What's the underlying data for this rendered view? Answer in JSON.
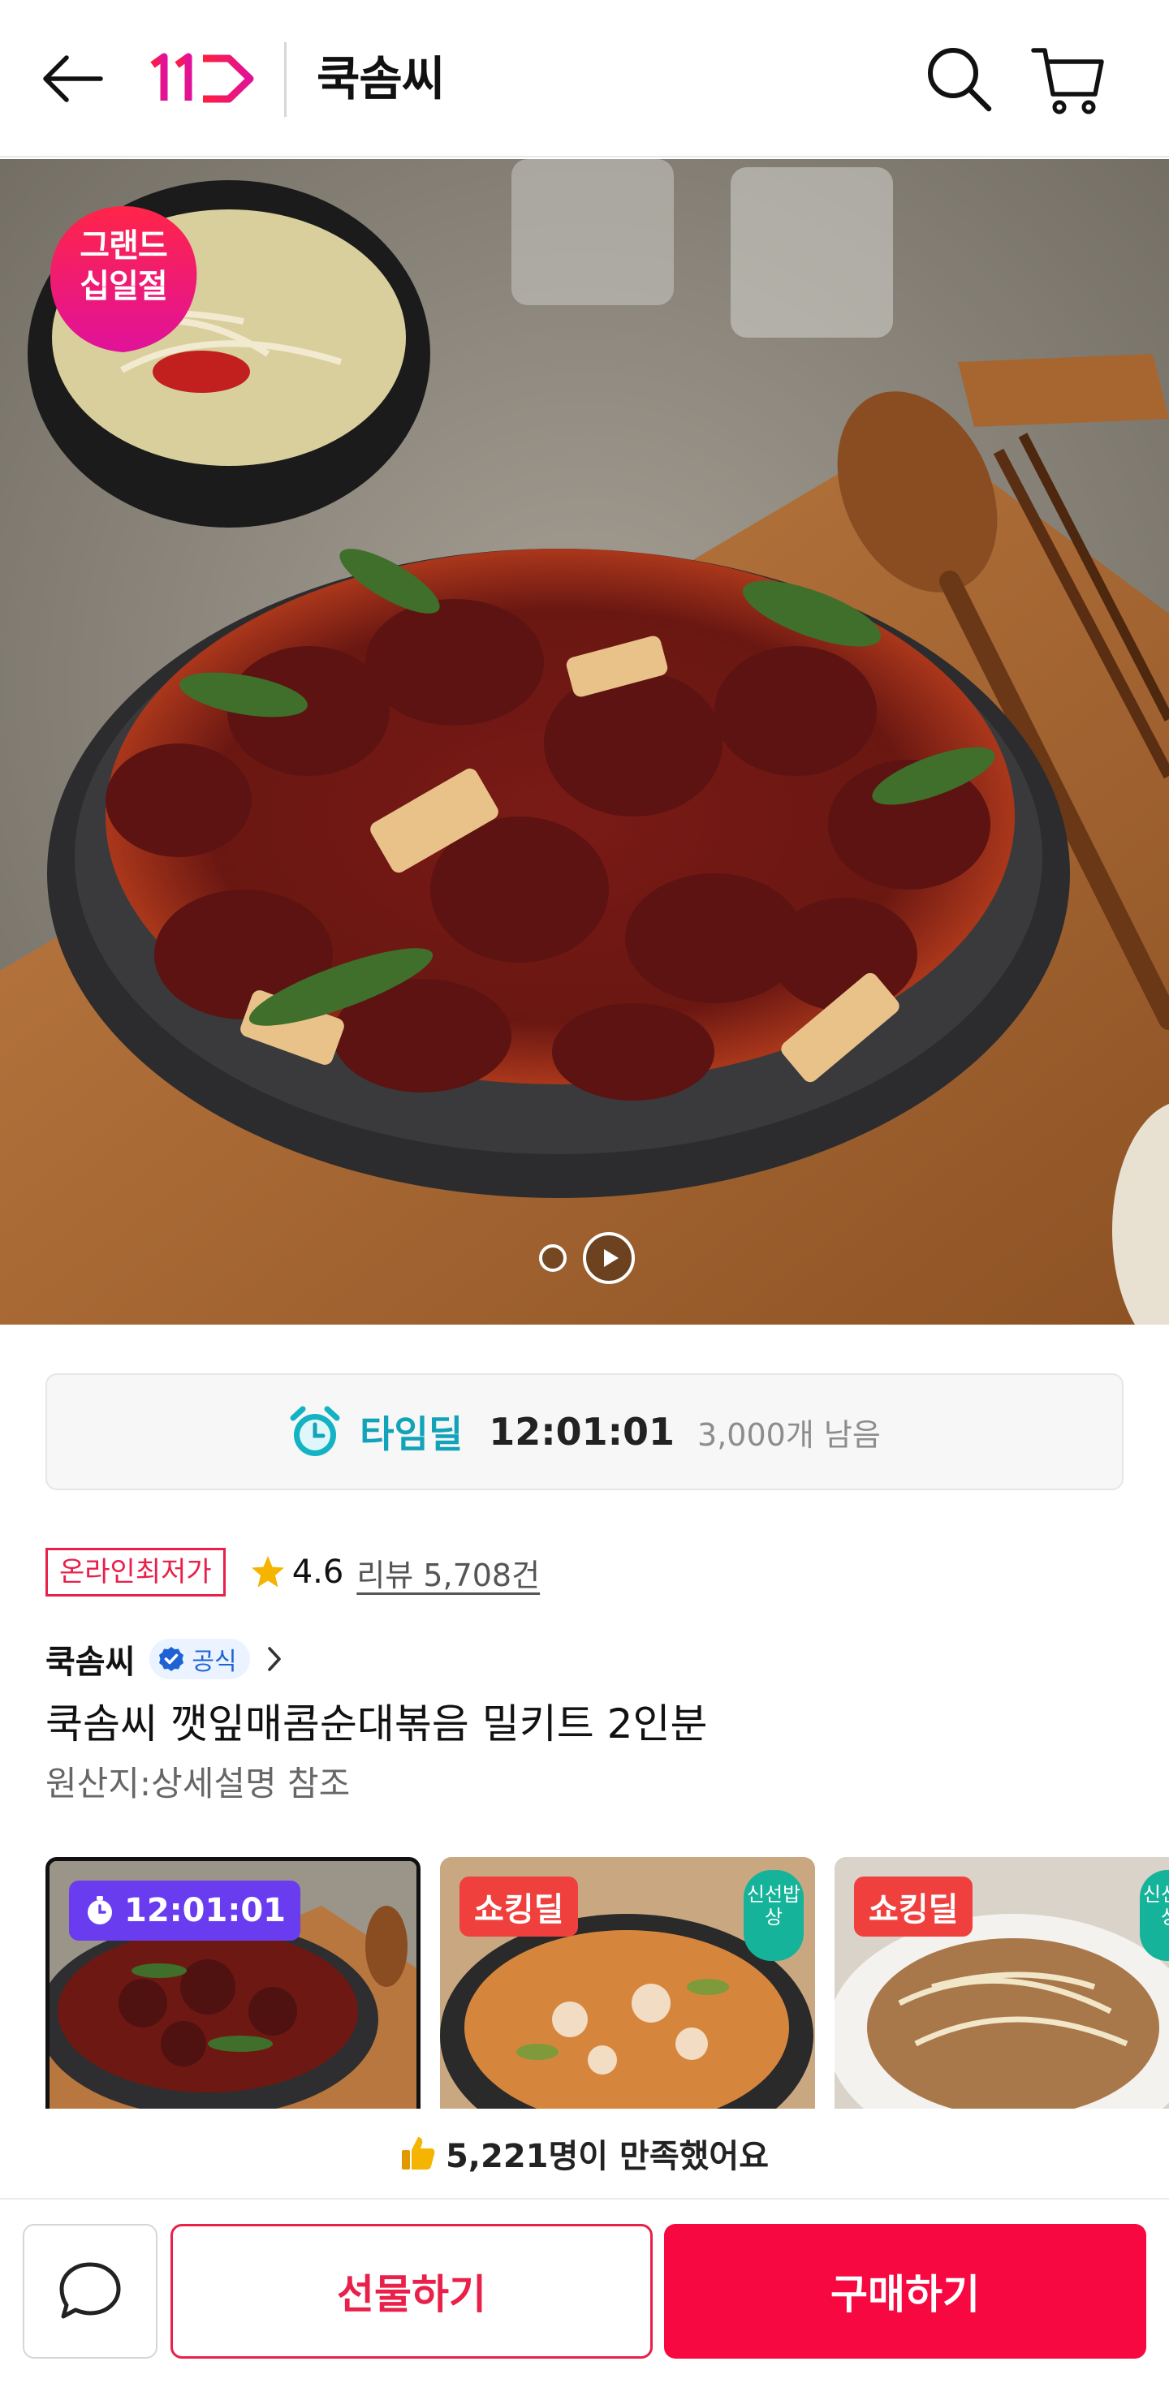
{
  "header": {
    "store_title": "쿡솜씨",
    "logo_text": "11"
  },
  "hero": {
    "badge_line1": "그랜드",
    "badge_line2": "십일절",
    "slide_count": 2,
    "current_slide": 1
  },
  "timedeal": {
    "label": "타임딜",
    "time": "12:01:01",
    "remaining": "3,000개 남음"
  },
  "info": {
    "lowest_badge": "온라인최저가",
    "rating": "4.6",
    "review_link": "리뷰 5,708건"
  },
  "product": {
    "seller": "쿡솜씨",
    "official_label": "공식",
    "title": "쿡솜씨 깻잎매콤순대볶음 밀키트 2인분",
    "origin": "원산지:상세설명 참조"
  },
  "cards": [
    {
      "tag": "12:01:01",
      "fresh_badge": ""
    },
    {
      "tag": "쇼킹딜",
      "fresh_badge": "신선밥상"
    },
    {
      "tag": "쇼킹딜",
      "fresh_badge": "신선밥상"
    }
  ],
  "satisfaction": {
    "text": "5,221명이 만족했어요"
  },
  "bottom_bar": {
    "gift_label": "선물하기",
    "buy_label": "구매하기"
  },
  "colors": {
    "brand_red": "#f80840",
    "timedeal_teal": "#12a3b8",
    "time_purple": "#6a3cf0",
    "shocking_red": "#f0403e",
    "fresh_green": "#14b39a"
  },
  "icons": [
    "back-arrow-icon",
    "search-icon",
    "cart-icon",
    "alarm-clock-icon",
    "star-icon",
    "verified-check-icon",
    "chevron-right-icon",
    "play-icon",
    "thumbs-up-icon",
    "chat-bubble-icon"
  ]
}
